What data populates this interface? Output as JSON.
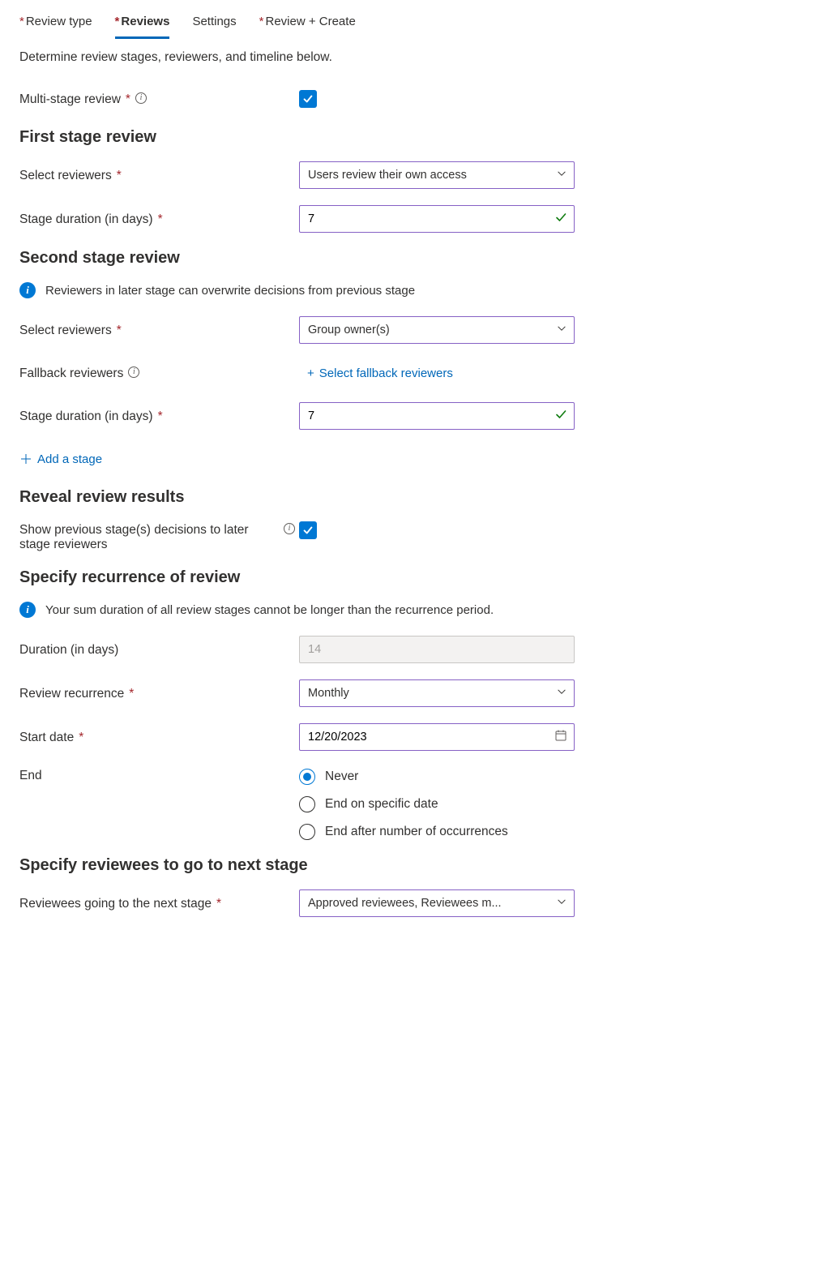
{
  "tabs": {
    "review_type": "Review type",
    "reviews": "Reviews",
    "settings": "Settings",
    "review_create": "Review + Create"
  },
  "intro": "Determine review stages, reviewers, and timeline below.",
  "multi_stage": {
    "label": "Multi-stage review",
    "checked": true
  },
  "first_stage": {
    "heading": "First stage review",
    "select_reviewers_label": "Select reviewers",
    "select_reviewers_value": "Users review their own access",
    "duration_label": "Stage duration (in days)",
    "duration_value": "7"
  },
  "second_stage": {
    "heading": "Second stage review",
    "info": "Reviewers in later stage can overwrite decisions from previous stage",
    "select_reviewers_label": "Select reviewers",
    "select_reviewers_value": "Group owner(s)",
    "fallback_label": "Fallback reviewers",
    "fallback_link": "Select fallback reviewers",
    "duration_label": "Stage duration (in days)",
    "duration_value": "7"
  },
  "add_stage_label": "Add a stage",
  "reveal": {
    "heading": "Reveal review results",
    "label": "Show previous stage(s) decisions to later stage reviewers",
    "checked": true
  },
  "recurrence": {
    "heading": "Specify recurrence of review",
    "info": "Your sum duration of all review stages cannot be longer than the recurrence period.",
    "duration_label": "Duration (in days)",
    "duration_value": "14",
    "recurrence_label": "Review recurrence",
    "recurrence_value": "Monthly",
    "start_label": "Start date",
    "start_value": "12/20/2023",
    "end_label": "End",
    "end_options": {
      "never": "Never",
      "specific": "End on specific date",
      "occurrences": "End after number of occurrences"
    }
  },
  "next_stage": {
    "heading": "Specify reviewees to go to next stage",
    "label": "Reviewees going to the next stage",
    "value": "Approved reviewees, Reviewees m..."
  }
}
